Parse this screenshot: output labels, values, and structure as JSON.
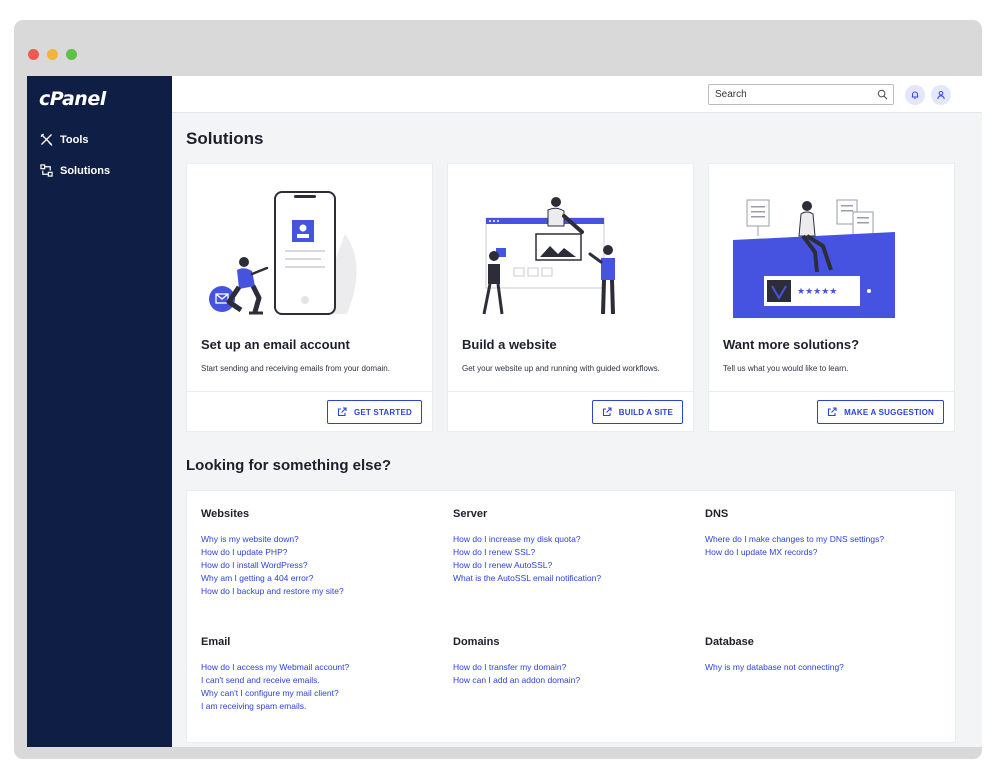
{
  "app": {
    "logo": "cPanel"
  },
  "sidebar": {
    "items": [
      {
        "label": "Tools",
        "icon": "tools-icon"
      },
      {
        "label": "Solutions",
        "icon": "solutions-icon"
      }
    ]
  },
  "topbar": {
    "search_placeholder": "Search"
  },
  "page": {
    "title": "Solutions"
  },
  "cards": [
    {
      "title": "Set up an email account",
      "description": "Start sending and receiving emails from your domain.",
      "button": "GET STARTED"
    },
    {
      "title": "Build a website",
      "description": "Get your website up and running with guided workflows.",
      "button": "BUILD A SITE"
    },
    {
      "title": "Want more solutions?",
      "description": "Tell us what you would like to learn.",
      "button": "MAKE A SUGGESTION"
    }
  ],
  "help": {
    "title": "Looking for something else?",
    "groups": [
      {
        "heading": "Websites",
        "links": [
          "Why is my website down?",
          "How do I update PHP?",
          "How do I install WordPress?",
          "Why am I getting a 404 error?",
          "How do I backup and restore my site?"
        ]
      },
      {
        "heading": "Server",
        "links": [
          "How do I increase my disk quota?",
          "How do I renew SSL?",
          "How do I renew AutoSSL?",
          "What is the AutoSSL email notification?"
        ]
      },
      {
        "heading": "DNS",
        "links": [
          "Where do I make changes to my DNS settings?",
          "How do I update MX records?"
        ]
      },
      {
        "heading": "Email",
        "links": [
          "How do I access my Webmail account?",
          "I can't send and receive emails.",
          "Why can't I configure my mail client?",
          "I am receiving spam emails."
        ]
      },
      {
        "heading": "Domains",
        "links": [
          "How do I transfer my domain?",
          "How can I add an addon domain?"
        ]
      },
      {
        "heading": "Database",
        "links": [
          "Why is my database not connecting?"
        ]
      }
    ]
  },
  "colors": {
    "sidebar": "#0f1e45",
    "accent": "#2c43d8",
    "illustration": "#4553e0"
  }
}
